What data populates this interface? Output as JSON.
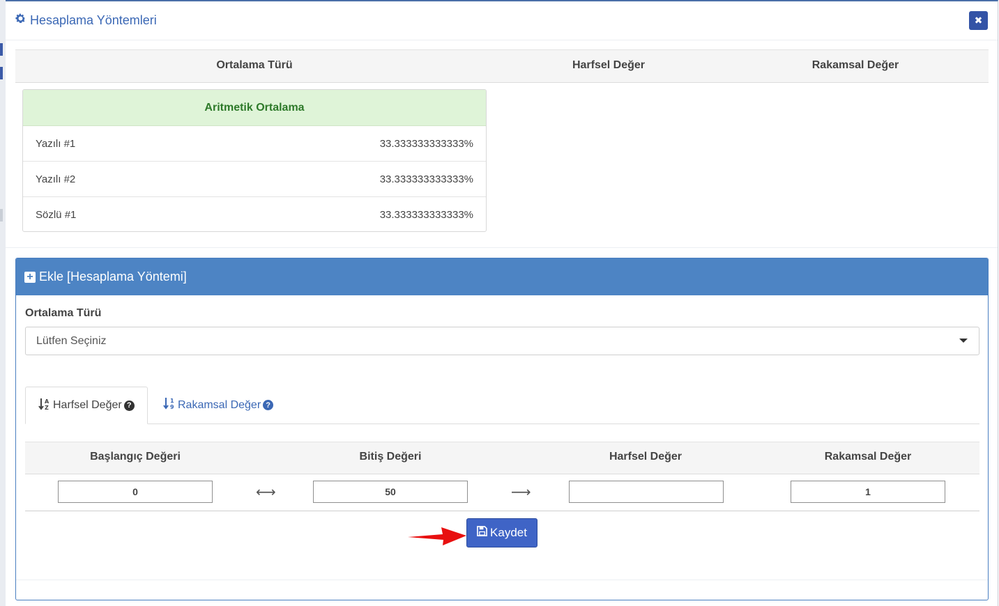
{
  "modal": {
    "title": "Hesaplama Yöntemleri",
    "title_icon": "gear-icon",
    "close_icon": "close-icon"
  },
  "methods_table": {
    "headers": [
      "Ortalama Türü",
      "Harfsel Değer",
      "Rakamsal Değer"
    ],
    "groups": [
      {
        "title": "Aritmetik Ortalama",
        "rows": [
          {
            "name": "Yazılı #1",
            "value": "33.333333333333%"
          },
          {
            "name": "Yazılı #2",
            "value": "33.333333333333%"
          },
          {
            "name": "Sözlü #1",
            "value": "33.333333333333%"
          }
        ]
      }
    ]
  },
  "add_panel": {
    "title": "Ekle [Hesaplama Yöntemi]",
    "title_icon": "plus-square-icon",
    "average_type_label": "Ortalama Türü",
    "average_type_selected": "Lütfen Seçiniz",
    "tabs": [
      {
        "label": "Harfsel Değer",
        "icon": "sort-alpha-icon",
        "active": true
      },
      {
        "label": "Rakamsal Değer",
        "icon": "sort-numeric-icon",
        "active": false
      }
    ],
    "range_headers": [
      "Başlangıç Değeri",
      "Bitiş Değeri",
      "Harfsel Değer",
      "Rakamsal Değer"
    ],
    "range_row": {
      "start": "0",
      "end": "50",
      "letter": "",
      "number": "1"
    },
    "save_label": "Kaydet",
    "save_icon": "save-icon"
  },
  "colors": {
    "accent": "#4d84c4",
    "button": "#3f64c6",
    "success_bg": "#dff4d8",
    "success_text": "#2e7a2a"
  }
}
